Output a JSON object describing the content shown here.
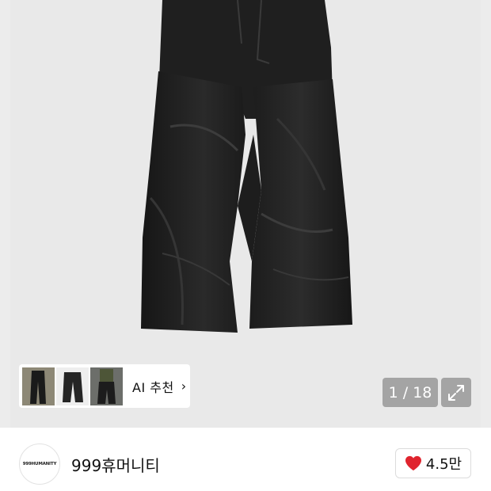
{
  "gallery": {
    "counter": "1 / 18",
    "ai_recommend_label": "AI 추천",
    "ai_recommend_chevron": "›",
    "thumbnails": [
      {
        "icon": "pants-outfit-photo"
      },
      {
        "icon": "pants-flat-photo"
      },
      {
        "icon": "pants-model-photo"
      }
    ],
    "expand_icon": "expand-icon"
  },
  "brand": {
    "logo_text": "999HUMANITY",
    "name": "999휴머니티"
  },
  "like": {
    "icon": "heart-icon",
    "count": "4.5만",
    "heart_color": "#e0242e"
  }
}
